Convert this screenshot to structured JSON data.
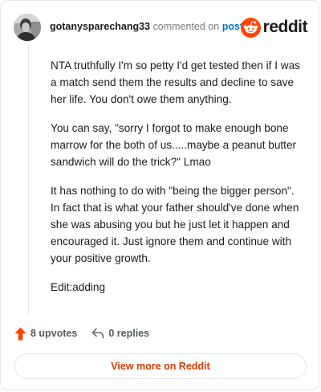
{
  "header": {
    "username": "gotanysparechang33",
    "commented_text": "commented on",
    "post_link": "post",
    "brand_name": "reddit"
  },
  "comment": {
    "paragraphs": [
      "NTA truthfully I'm so petty I'd get tested then if I was a match send them the results and decline to save her life. You don't owe them anything.",
      "You can say, \"sorry I forgot to make enough bone marrow for the both of us.....maybe a peanut butter sandwich will do the trick?\" Lmao",
      "It has nothing to do with \"being the bigger person\". In fact that is what your father should've done when she was abusing you but he just let it happen and encouraged it. Just ignore them and continue with your positive growth.",
      "Edit:adding"
    ]
  },
  "actions": {
    "upvotes": "8 upvotes",
    "replies": "0 replies"
  },
  "footer": {
    "view_more": "View more on Reddit"
  },
  "colors": {
    "brand_orange": "#FF4500",
    "link_blue": "#0079D3",
    "cta_orange": "#D93A00"
  },
  "icons": {
    "avatar": "user-avatar",
    "brand": "reddit-snoo-icon",
    "upvote": "upvote-arrow-icon",
    "reply": "reply-arrow-icon"
  }
}
